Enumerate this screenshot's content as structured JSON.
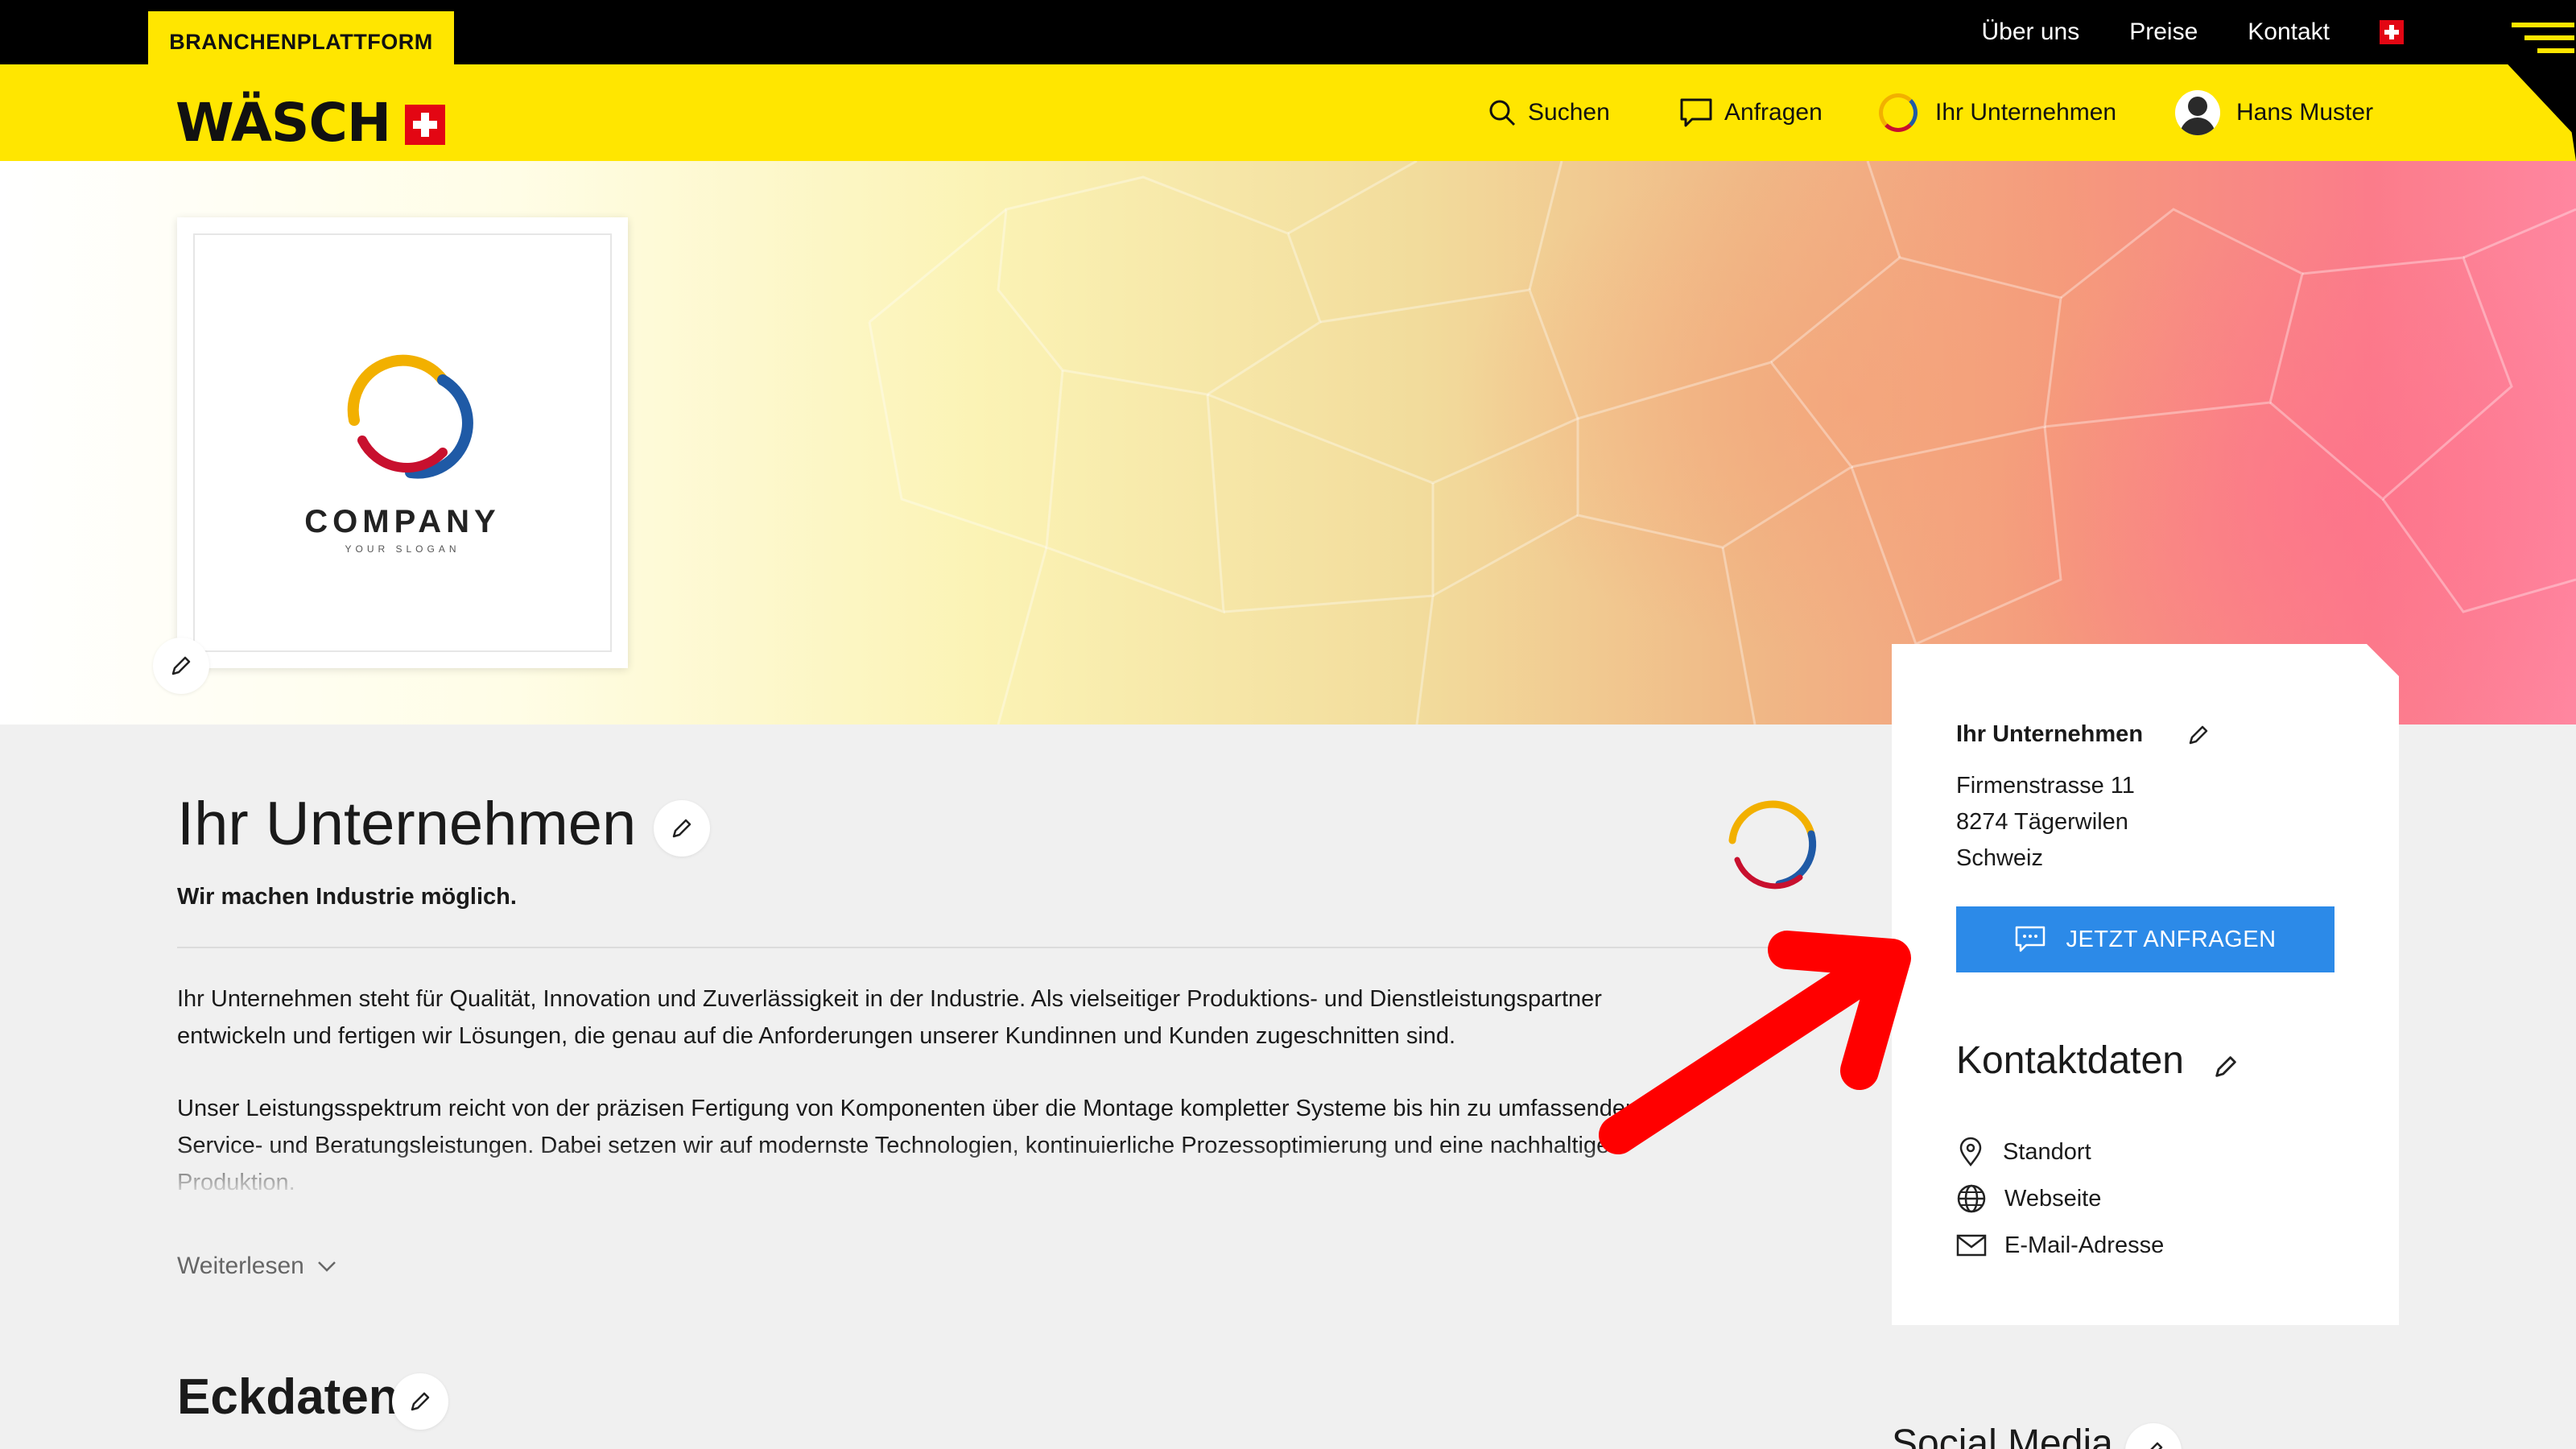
{
  "topbar": {
    "platform_label": "BRANCHENPLATTFORM",
    "links": [
      "Über uns",
      "Preise",
      "Kontakt"
    ]
  },
  "header": {
    "logo_text": "WÄSCH",
    "nav": {
      "search": "Suchen",
      "requests": "Anfragen",
      "company": "Ihr Unternehmen",
      "user": "Hans Muster"
    }
  },
  "logo_card": {
    "company": "COMPANY",
    "slogan": "YOUR SLOGAN"
  },
  "main": {
    "title": "Ihr Unternehmen",
    "tagline": "Wir machen Industrie möglich.",
    "paragraph1": "Ihr Unternehmen steht für Qualität, Innovation und Zuverlässigkeit in der Industrie. Als vielseitiger Produktions- und Dienstleistungspartner entwickeln und fertigen wir Lösungen, die genau auf die Anforderungen unserer Kundinnen und Kunden zugeschnitten sind.",
    "paragraph2": "Unser Leistungsspektrum reicht von der präzisen Fertigung von Komponenten über die Montage kompletter Systeme bis hin zu umfassenden Service- und Beratungsleistungen. Dabei setzen wir auf modernste Technologien, kontinuierliche Prozessoptimierung und eine nachhaltige Produktion.",
    "read_more": "Weiterlesen",
    "section2_title": "Eckdaten"
  },
  "sidebar": {
    "company_name": "Ihr Unternehmen",
    "street": "Firmenstrasse 11",
    "city": "8274 Tägerwilen",
    "country": "Schweiz",
    "cta_label": "JETZT ANFRAGEN",
    "contact_title": "Kontaktdaten",
    "contact_items": [
      "Standort",
      "Webseite",
      "E-Mail-Adresse"
    ],
    "social_title": "Social Media"
  },
  "colors": {
    "brand_yellow": "#ffe600",
    "cta_blue": "#2c8ae8",
    "swiss_red": "#e30613",
    "annotation_arrow": "#ff0000"
  }
}
